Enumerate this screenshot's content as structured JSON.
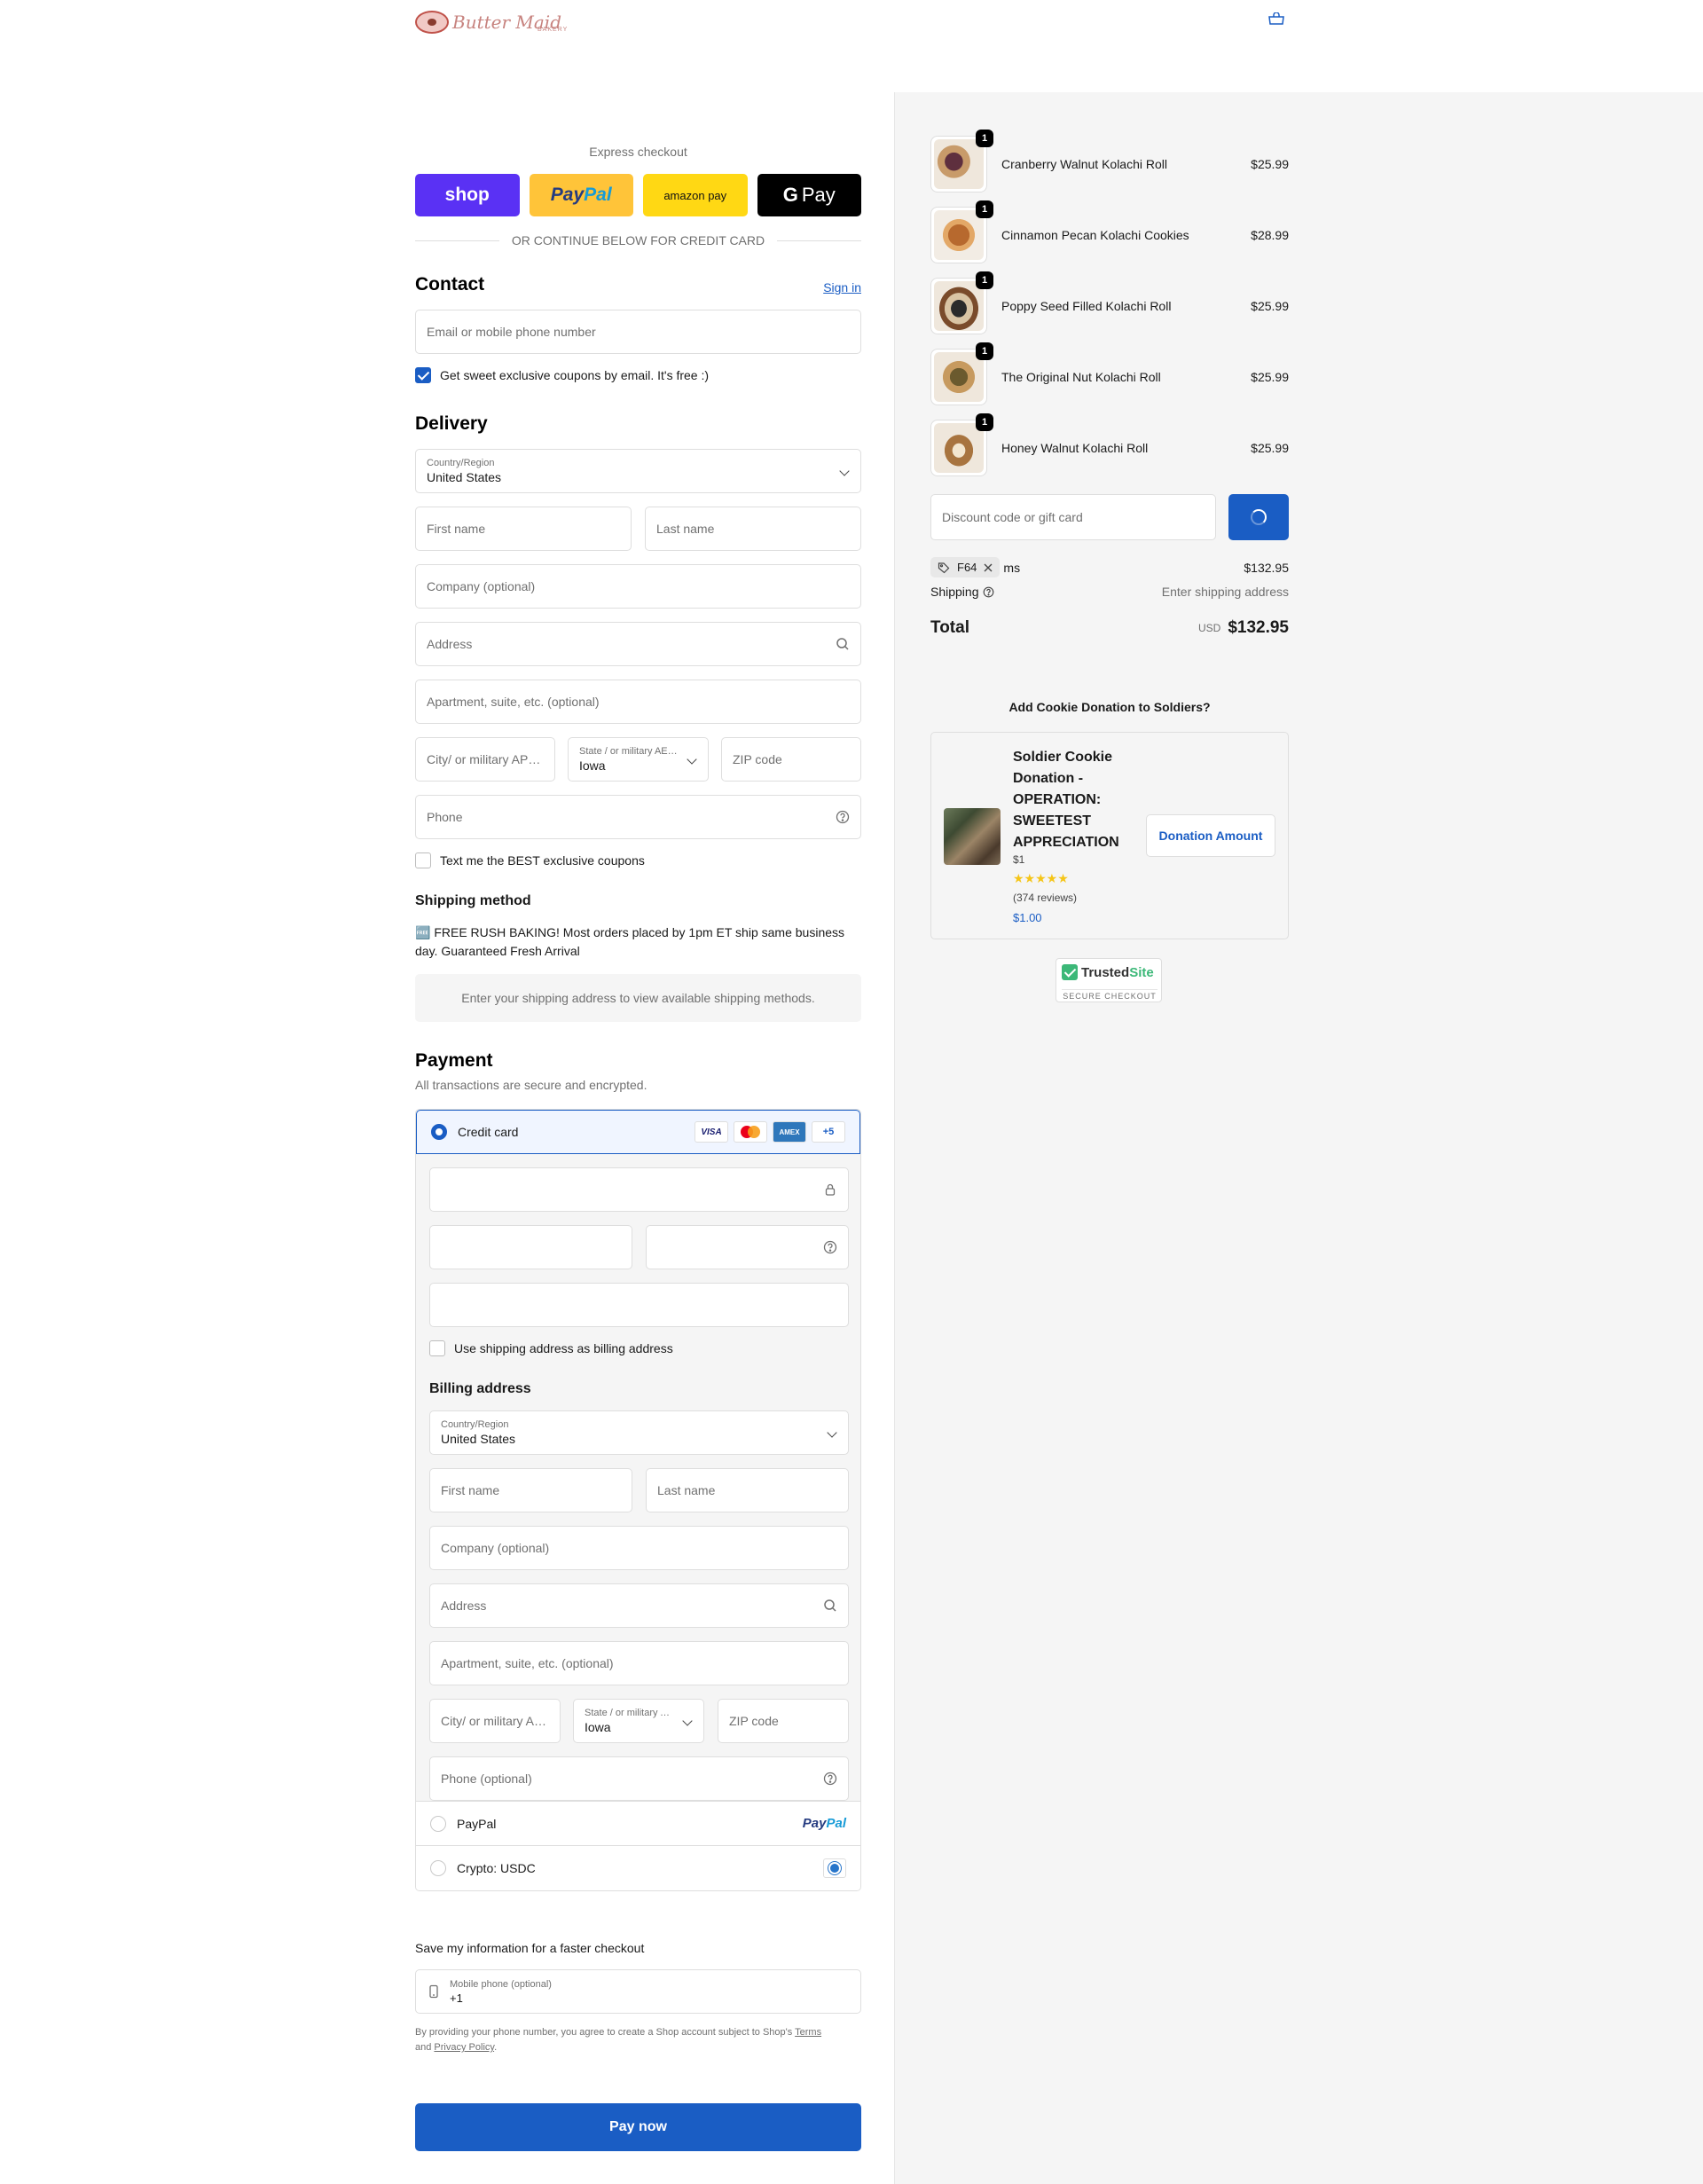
{
  "header": {
    "logo_text": "Butter Maid",
    "logo_sub": "BAKERY"
  },
  "express": {
    "title": "Express checkout",
    "shop_label": "shop",
    "paypal_label_a": "Pay",
    "paypal_label_b": "Pal",
    "amazon_label": "amazon pay",
    "gpay_g": "G",
    "gpay_label": "Pay",
    "divider": "OR CONTINUE BELOW FOR CREDIT CARD"
  },
  "contact": {
    "title": "Contact",
    "sign_in": "Sign in",
    "email_placeholder": "Email or mobile phone number",
    "coupons_label": "Get sweet exclusive coupons by email. It's free :)"
  },
  "delivery": {
    "title": "Delivery",
    "country_label": "Country/Region",
    "country_value": "United States",
    "first_name": "First name",
    "last_name": "Last name",
    "company": "Company (optional)",
    "address": "Address",
    "apartment": "Apartment, suite, etc. (optional)",
    "city": "City/ or military APO/FPO",
    "state_label": "State / or military AE/AA/AP",
    "state_value": "Iowa",
    "zip": "ZIP code",
    "phone": "Phone",
    "text_coupons": "Text me the BEST exclusive coupons"
  },
  "shipping": {
    "title": "Shipping method",
    "note": "🆓 FREE RUSH BAKING! Most orders placed by 1pm ET ship same business day. Guaranteed Fresh Arrival",
    "placeholder": "Enter your shipping address to view available shipping methods."
  },
  "payment": {
    "title": "Payment",
    "subtitle": "All transactions are secure and encrypted.",
    "credit_card": "Credit card",
    "brand_visa": "VISA",
    "brand_amex": "AMEX",
    "brand_more": "+5",
    "use_shipping": "Use shipping address as billing address",
    "billing_title": "Billing address",
    "billing": {
      "country_label": "Country/Region",
      "country_value": "United States",
      "first_name": "First name",
      "last_name": "Last name",
      "company": "Company (optional)",
      "address": "Address",
      "apartment": "Apartment, suite, etc. (optional)",
      "city": "City/ or military APO/FPO",
      "state_label": "State / or military AE/AA/AP",
      "state_value": "Iowa",
      "zip": "ZIP code",
      "phone": "Phone (optional)"
    },
    "paypal": "PayPal",
    "paypal_logo_a": "Pay",
    "paypal_logo_b": "Pal",
    "crypto": "Crypto: USDC"
  },
  "save": {
    "title": "Save my information for a faster checkout",
    "mobile_label": "Mobile phone (optional)",
    "mobile_value": "+1",
    "legal_a": "By providing your phone number, you agree to create a Shop account subject to Shop's",
    "terms": "Terms",
    "legal_and": "and",
    "privacy": "Privacy Policy",
    "legal_end": "."
  },
  "pay_now": "Pay now",
  "cart": {
    "items": [
      {
        "name": "Cranberry Walnut Kolachi Roll",
        "price": "$25.99",
        "qty": "1"
      },
      {
        "name": "Cinnamon Pecan Kolachi Cookies",
        "price": "$28.99",
        "qty": "1"
      },
      {
        "name": "Poppy Seed Filled Kolachi Roll",
        "price": "$25.99",
        "qty": "1"
      },
      {
        "name": "The Original Nut Kolachi Roll",
        "price": "$25.99",
        "qty": "1"
      },
      {
        "name": "Honey Walnut Kolachi Roll",
        "price": "$25.99",
        "qty": "1"
      }
    ],
    "discount_placeholder": "Discount code or gift card",
    "code_chip": "F64",
    "subtotal_suffix": "ms",
    "subtotal": "$132.95",
    "shipping_label": "Shipping",
    "shipping_value": "Enter shipping address",
    "total_label": "Total",
    "currency": "USD",
    "total": "$132.95"
  },
  "donation": {
    "title": "Add Cookie Donation to Soldiers?",
    "name": "Soldier Cookie Donation - OPERATION: SWEETEST APPRECIATION",
    "amount_small": "$1",
    "stars": "★★★★★",
    "reviews": "(374 reviews)",
    "price": "$1.00",
    "button": "Donation Amount"
  },
  "trusted": {
    "brand_a": "Trusted",
    "brand_b": "Site",
    "sub": "SECURE CHECKOUT"
  },
  "colors": {
    "accent": "#1a5dc4",
    "shop": "#5a31f4",
    "paypal": "#ffc439",
    "amazon": "#ffd814"
  }
}
